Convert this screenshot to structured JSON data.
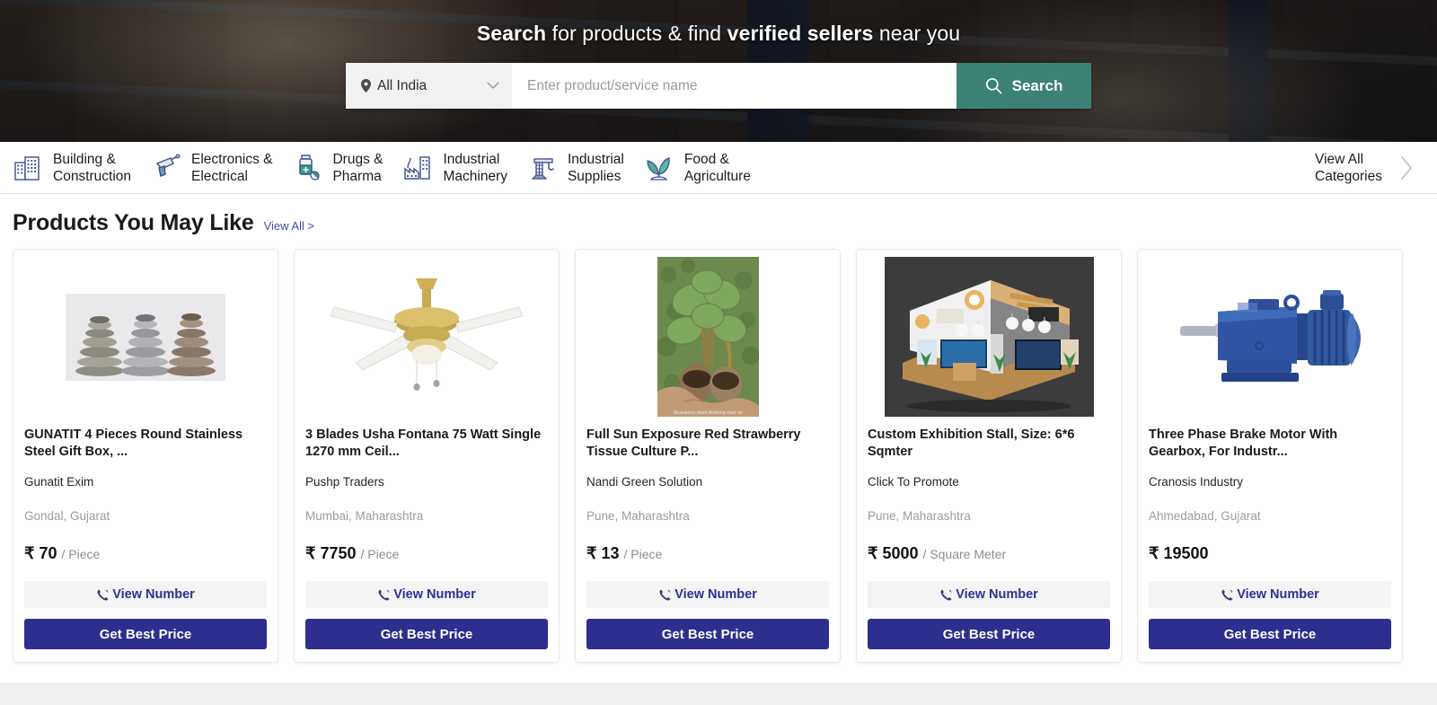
{
  "hero": {
    "title_parts": [
      {
        "text": "Search",
        "bold": true
      },
      {
        "text": " for products & find ",
        "bold": false
      },
      {
        "text": "verified sellers",
        "bold": true
      },
      {
        "text": " near you",
        "bold": false
      }
    ],
    "title_plain": "Search for products & find verified sellers near you",
    "location": {
      "value": "All India",
      "pin_icon": "location-pin-icon",
      "chevron_icon": "chevron-down-icon"
    },
    "search": {
      "value": "",
      "placeholder": "Enter product/service name",
      "button_label": "Search",
      "button_icon": "search-icon",
      "button_color": "#3b8274"
    }
  },
  "categories": {
    "items": [
      {
        "label": "Building &\nConstruction",
        "icon": "building-icon"
      },
      {
        "label": "Electronics &\nElectrical",
        "icon": "drill-icon"
      },
      {
        "label": "Drugs &\nPharma",
        "icon": "medicine-bottle-icon"
      },
      {
        "label": "Industrial\nMachinery",
        "icon": "factory-icon"
      },
      {
        "label": "Industrial\nSupplies",
        "icon": "crane-icon"
      },
      {
        "label": "Food &\nAgriculture",
        "icon": "sprout-icon"
      }
    ],
    "view_all": {
      "label": "View All\nCategories",
      "icon": "chevron-right-icon"
    }
  },
  "products_section": {
    "title": "Products You May Like",
    "view_all_label": "View All >",
    "cards": [
      {
        "title": "GUNATIT 4 Pieces Round Stainless Steel Gift Box, ...",
        "seller": "Gunatit Exim",
        "location": "Gondal, Gujarat",
        "currency": "₹",
        "price": "70",
        "unit": "/ Piece",
        "view_number_label": "View Number",
        "get_best_price_label": "Get Best Price",
        "image": "stainless-steel-containers-photo"
      },
      {
        "title": "3 Blades Usha Fontana 75 Watt Single 1270 mm Ceil...",
        "seller": "Pushp Traders",
        "location": "Mumbai, Maharashtra",
        "currency": "₹",
        "price": "7750",
        "unit": "/ Piece",
        "view_number_label": "View Number",
        "get_best_price_label": "Get Best Price",
        "image": "ceiling-fan-photo"
      },
      {
        "title": "Full Sun Exposure Red Strawberry Tissue Culture P...",
        "seller": "Nandi Green Solution",
        "location": "Pune, Maharashtra",
        "currency": "₹",
        "price": "13",
        "unit": "/ Piece",
        "view_number_label": "View Number",
        "get_best_price_label": "Get Best Price",
        "image": "strawberry-plant-photo",
        "image_caption": "Strawberry plant Booking start on"
      },
      {
        "title": "Custom Exhibition Stall, Size: 6*6 Sqmter",
        "seller": "Click To Promote",
        "location": "Pune, Maharashtra",
        "currency": "₹",
        "price": "5000",
        "unit": "/ Square Meter",
        "view_number_label": "View Number",
        "get_best_price_label": "Get Best Price",
        "image": "exhibition-stall-photo"
      },
      {
        "title": "Three Phase Brake Motor With Gearbox, For Industr...",
        "seller": "Cranosis Industry",
        "location": "Ahmedabad, Gujarat",
        "currency": "₹",
        "price": "19500",
        "unit": "",
        "view_number_label": "View Number",
        "get_best_price_label": "Get Best Price",
        "image": "gearbox-motor-photo"
      }
    ]
  },
  "colors": {
    "primary_button": "#2e2e8f",
    "link": "#3b4fb5",
    "search_button": "#3b8274",
    "page_background": "#f0f0f0"
  }
}
